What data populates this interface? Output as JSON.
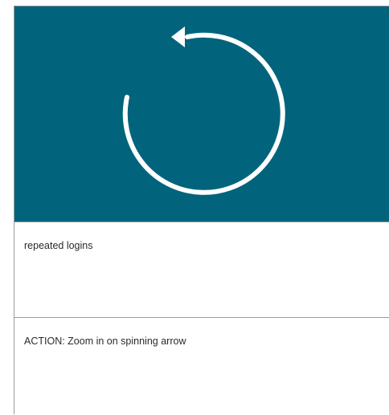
{
  "frame": {
    "background_color": "#01647c",
    "icon": "refresh-arrow-icon",
    "icon_color": "#ffffff"
  },
  "scene": {
    "caption": "repeated logins"
  },
  "action": {
    "caption": "ACTION: Zoom in on spinning arrow"
  }
}
